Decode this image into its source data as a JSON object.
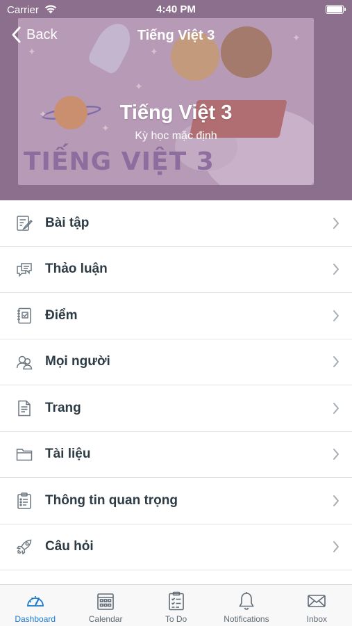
{
  "status_bar": {
    "carrier": "Carrier",
    "time": "4:40 PM"
  },
  "nav": {
    "back_label": "Back",
    "title": "Tiếng Việt 3"
  },
  "course": {
    "title": "Tiếng Việt 3",
    "term": "Kỳ học mặc định",
    "banner_text": "TIẾNG VIỆT 3"
  },
  "menu": [
    {
      "label": "Bài tập",
      "icon": "assignments-icon"
    },
    {
      "label": "Thảo luận",
      "icon": "discussions-icon"
    },
    {
      "label": "Điểm",
      "icon": "grades-icon"
    },
    {
      "label": "Mọi người",
      "icon": "people-icon"
    },
    {
      "label": "Trang",
      "icon": "pages-icon"
    },
    {
      "label": "Tài liệu",
      "icon": "files-icon"
    },
    {
      "label": "Thông tin quan trọng",
      "icon": "syllabus-icon"
    },
    {
      "label": "Câu hỏi",
      "icon": "quizzes-icon"
    }
  ],
  "tabs": [
    {
      "label": "Dashboard",
      "icon": "dashboard-icon",
      "active": true
    },
    {
      "label": "Calendar",
      "icon": "calendar-icon",
      "active": false
    },
    {
      "label": "To Do",
      "icon": "todo-icon",
      "active": false
    },
    {
      "label": "Notifications",
      "icon": "bell-icon",
      "active": false
    },
    {
      "label": "Inbox",
      "icon": "inbox-icon",
      "active": false
    }
  ],
  "colors": {
    "active_tab": "#1a7ad0",
    "header_overlay": "#8c6f8c",
    "text_primary": "#2d3b45"
  }
}
